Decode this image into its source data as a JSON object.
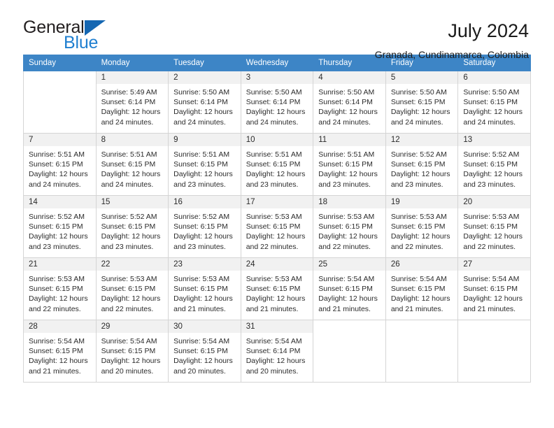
{
  "brand": {
    "name_part1": "General",
    "name_part2": "Blue",
    "triangle_color": "#1567b2",
    "blue_color": "#1f7fd0"
  },
  "header": {
    "month_title": "July 2024",
    "location": "Granada, Cundinamarca, Colombia"
  },
  "theme": {
    "header_bg": "#3d85c6",
    "daynum_bg": "#f1f1f1",
    "border": "#d5d5d5"
  },
  "weekday_headers": [
    "Sunday",
    "Monday",
    "Tuesday",
    "Wednesday",
    "Thursday",
    "Friday",
    "Saturday"
  ],
  "labels": {
    "sunrise_prefix": "Sunrise: ",
    "sunset_prefix": "Sunset: ",
    "daylight_prefix": "Daylight: "
  },
  "weeks": [
    [
      {
        "day": "",
        "sunrise": "",
        "sunset": "",
        "daylight_line1": "",
        "daylight_line2": "",
        "empty": true
      },
      {
        "day": "1",
        "sunrise": "Sunrise: 5:49 AM",
        "sunset": "Sunset: 6:14 PM",
        "daylight_line1": "Daylight: 12 hours",
        "daylight_line2": "and 24 minutes.",
        "empty": false
      },
      {
        "day": "2",
        "sunrise": "Sunrise: 5:50 AM",
        "sunset": "Sunset: 6:14 PM",
        "daylight_line1": "Daylight: 12 hours",
        "daylight_line2": "and 24 minutes.",
        "empty": false
      },
      {
        "day": "3",
        "sunrise": "Sunrise: 5:50 AM",
        "sunset": "Sunset: 6:14 PM",
        "daylight_line1": "Daylight: 12 hours",
        "daylight_line2": "and 24 minutes.",
        "empty": false
      },
      {
        "day": "4",
        "sunrise": "Sunrise: 5:50 AM",
        "sunset": "Sunset: 6:14 PM",
        "daylight_line1": "Daylight: 12 hours",
        "daylight_line2": "and 24 minutes.",
        "empty": false
      },
      {
        "day": "5",
        "sunrise": "Sunrise: 5:50 AM",
        "sunset": "Sunset: 6:15 PM",
        "daylight_line1": "Daylight: 12 hours",
        "daylight_line2": "and 24 minutes.",
        "empty": false
      },
      {
        "day": "6",
        "sunrise": "Sunrise: 5:50 AM",
        "sunset": "Sunset: 6:15 PM",
        "daylight_line1": "Daylight: 12 hours",
        "daylight_line2": "and 24 minutes.",
        "empty": false
      }
    ],
    [
      {
        "day": "7",
        "sunrise": "Sunrise: 5:51 AM",
        "sunset": "Sunset: 6:15 PM",
        "daylight_line1": "Daylight: 12 hours",
        "daylight_line2": "and 24 minutes.",
        "empty": false
      },
      {
        "day": "8",
        "sunrise": "Sunrise: 5:51 AM",
        "sunset": "Sunset: 6:15 PM",
        "daylight_line1": "Daylight: 12 hours",
        "daylight_line2": "and 24 minutes.",
        "empty": false
      },
      {
        "day": "9",
        "sunrise": "Sunrise: 5:51 AM",
        "sunset": "Sunset: 6:15 PM",
        "daylight_line1": "Daylight: 12 hours",
        "daylight_line2": "and 23 minutes.",
        "empty": false
      },
      {
        "day": "10",
        "sunrise": "Sunrise: 5:51 AM",
        "sunset": "Sunset: 6:15 PM",
        "daylight_line1": "Daylight: 12 hours",
        "daylight_line2": "and 23 minutes.",
        "empty": false
      },
      {
        "day": "11",
        "sunrise": "Sunrise: 5:51 AM",
        "sunset": "Sunset: 6:15 PM",
        "daylight_line1": "Daylight: 12 hours",
        "daylight_line2": "and 23 minutes.",
        "empty": false
      },
      {
        "day": "12",
        "sunrise": "Sunrise: 5:52 AM",
        "sunset": "Sunset: 6:15 PM",
        "daylight_line1": "Daylight: 12 hours",
        "daylight_line2": "and 23 minutes.",
        "empty": false
      },
      {
        "day": "13",
        "sunrise": "Sunrise: 5:52 AM",
        "sunset": "Sunset: 6:15 PM",
        "daylight_line1": "Daylight: 12 hours",
        "daylight_line2": "and 23 minutes.",
        "empty": false
      }
    ],
    [
      {
        "day": "14",
        "sunrise": "Sunrise: 5:52 AM",
        "sunset": "Sunset: 6:15 PM",
        "daylight_line1": "Daylight: 12 hours",
        "daylight_line2": "and 23 minutes.",
        "empty": false
      },
      {
        "day": "15",
        "sunrise": "Sunrise: 5:52 AM",
        "sunset": "Sunset: 6:15 PM",
        "daylight_line1": "Daylight: 12 hours",
        "daylight_line2": "and 23 minutes.",
        "empty": false
      },
      {
        "day": "16",
        "sunrise": "Sunrise: 5:52 AM",
        "sunset": "Sunset: 6:15 PM",
        "daylight_line1": "Daylight: 12 hours",
        "daylight_line2": "and 23 minutes.",
        "empty": false
      },
      {
        "day": "17",
        "sunrise": "Sunrise: 5:53 AM",
        "sunset": "Sunset: 6:15 PM",
        "daylight_line1": "Daylight: 12 hours",
        "daylight_line2": "and 22 minutes.",
        "empty": false
      },
      {
        "day": "18",
        "sunrise": "Sunrise: 5:53 AM",
        "sunset": "Sunset: 6:15 PM",
        "daylight_line1": "Daylight: 12 hours",
        "daylight_line2": "and 22 minutes.",
        "empty": false
      },
      {
        "day": "19",
        "sunrise": "Sunrise: 5:53 AM",
        "sunset": "Sunset: 6:15 PM",
        "daylight_line1": "Daylight: 12 hours",
        "daylight_line2": "and 22 minutes.",
        "empty": false
      },
      {
        "day": "20",
        "sunrise": "Sunrise: 5:53 AM",
        "sunset": "Sunset: 6:15 PM",
        "daylight_line1": "Daylight: 12 hours",
        "daylight_line2": "and 22 minutes.",
        "empty": false
      }
    ],
    [
      {
        "day": "21",
        "sunrise": "Sunrise: 5:53 AM",
        "sunset": "Sunset: 6:15 PM",
        "daylight_line1": "Daylight: 12 hours",
        "daylight_line2": "and 22 minutes.",
        "empty": false
      },
      {
        "day": "22",
        "sunrise": "Sunrise: 5:53 AM",
        "sunset": "Sunset: 6:15 PM",
        "daylight_line1": "Daylight: 12 hours",
        "daylight_line2": "and 22 minutes.",
        "empty": false
      },
      {
        "day": "23",
        "sunrise": "Sunrise: 5:53 AM",
        "sunset": "Sunset: 6:15 PM",
        "daylight_line1": "Daylight: 12 hours",
        "daylight_line2": "and 21 minutes.",
        "empty": false
      },
      {
        "day": "24",
        "sunrise": "Sunrise: 5:53 AM",
        "sunset": "Sunset: 6:15 PM",
        "daylight_line1": "Daylight: 12 hours",
        "daylight_line2": "and 21 minutes.",
        "empty": false
      },
      {
        "day": "25",
        "sunrise": "Sunrise: 5:54 AM",
        "sunset": "Sunset: 6:15 PM",
        "daylight_line1": "Daylight: 12 hours",
        "daylight_line2": "and 21 minutes.",
        "empty": false
      },
      {
        "day": "26",
        "sunrise": "Sunrise: 5:54 AM",
        "sunset": "Sunset: 6:15 PM",
        "daylight_line1": "Daylight: 12 hours",
        "daylight_line2": "and 21 minutes.",
        "empty": false
      },
      {
        "day": "27",
        "sunrise": "Sunrise: 5:54 AM",
        "sunset": "Sunset: 6:15 PM",
        "daylight_line1": "Daylight: 12 hours",
        "daylight_line2": "and 21 minutes.",
        "empty": false
      }
    ],
    [
      {
        "day": "28",
        "sunrise": "Sunrise: 5:54 AM",
        "sunset": "Sunset: 6:15 PM",
        "daylight_line1": "Daylight: 12 hours",
        "daylight_line2": "and 21 minutes.",
        "empty": false
      },
      {
        "day": "29",
        "sunrise": "Sunrise: 5:54 AM",
        "sunset": "Sunset: 6:15 PM",
        "daylight_line1": "Daylight: 12 hours",
        "daylight_line2": "and 20 minutes.",
        "empty": false
      },
      {
        "day": "30",
        "sunrise": "Sunrise: 5:54 AM",
        "sunset": "Sunset: 6:15 PM",
        "daylight_line1": "Daylight: 12 hours",
        "daylight_line2": "and 20 minutes.",
        "empty": false
      },
      {
        "day": "31",
        "sunrise": "Sunrise: 5:54 AM",
        "sunset": "Sunset: 6:14 PM",
        "daylight_line1": "Daylight: 12 hours",
        "daylight_line2": "and 20 minutes.",
        "empty": false
      },
      {
        "day": "",
        "sunrise": "",
        "sunset": "",
        "daylight_line1": "",
        "daylight_line2": "",
        "empty": true
      },
      {
        "day": "",
        "sunrise": "",
        "sunset": "",
        "daylight_line1": "",
        "daylight_line2": "",
        "empty": true
      },
      {
        "day": "",
        "sunrise": "",
        "sunset": "",
        "daylight_line1": "",
        "daylight_line2": "",
        "empty": true
      }
    ]
  ]
}
